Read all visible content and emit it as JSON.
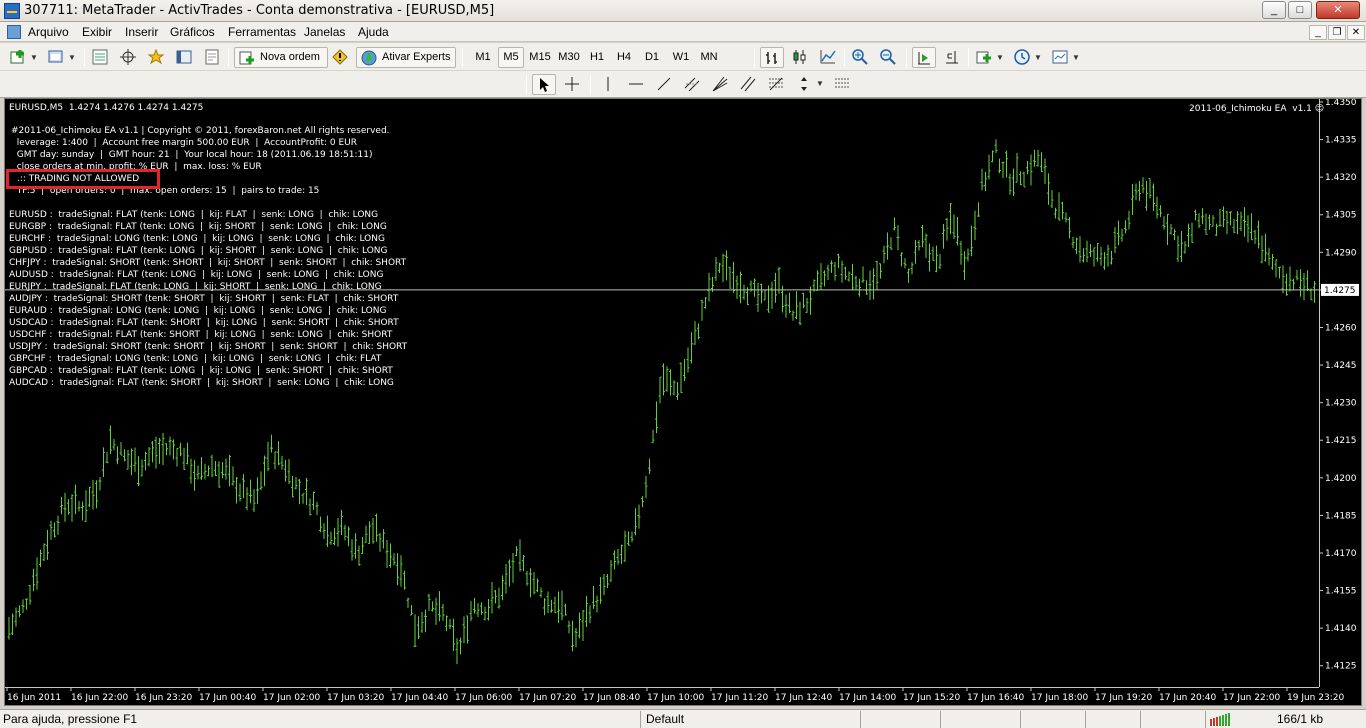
{
  "window": {
    "title": "307711: MetaTrader - ActivTrades - Conta demonstrativa - [EURUSD,M5]",
    "minimize": "_",
    "maximize": "□",
    "close": "✕"
  },
  "menu": {
    "items": [
      "Arquivo",
      "Exibir",
      "Inserir",
      "Gráficos",
      "Ferramentas",
      "Janelas",
      "Ajuda"
    ]
  },
  "toolbar": {
    "new_order": "Nova ordem",
    "experts": "Ativar Experts",
    "timeframes": [
      "M1",
      "M5",
      "M15",
      "M30",
      "H1",
      "H4",
      "D1",
      "W1",
      "MN"
    ],
    "active_timeframe": "M5"
  },
  "chart": {
    "header": "EURUSD,M5  1.4274 1.4276 1.4274 1.4275",
    "ea_label": "2011-06_Ichimoku EA  v1.1 ☺",
    "info_lines": [
      "#2011-06_Ichimoku EA v1.1 | Copyright © 2011, forexBaron.net All rights reserved.",
      "  leverage: 1:400  |  Account free margin 500.00 EUR  |  AccountProfit: 0 EUR",
      "  GMT day: sunday  |  GMT hour: 21  |  Your local hour: 18 (2011.06.19 18:51:11)",
      "  close orders at min. profit: % EUR  |  max. loss: % EUR",
      "",
      "  TF:5  |  open orders: 0  |  max. open orders: 15  |  pairs to trade: 15"
    ],
    "trading_status": ".:: TRADING NOT ALLOWED",
    "signals": [
      "EURUSD :  tradeSignal: FLAT (tenk: LONG  |  kij: FLAT  |  senk: LONG  |  chik: LONG",
      "EURGBP :  tradeSignal: FLAT (tenk: LONG  |  kij: SHORT  |  senk: LONG  |  chik: LONG",
      "EURCHF :  tradeSignal: LONG (tenk: LONG  |  kij: LONG  |  senk: LONG  |  chik: LONG",
      "GBPUSD :  tradeSignal: FLAT (tenk: LONG  |  kij: SHORT  |  senk: LONG  |  chik: LONG",
      "CHFJPY :  tradeSignal: SHORT (tenk: SHORT  |  kij: SHORT  |  senk: SHORT  |  chik: SHORT",
      "AUDUSD :  tradeSignal: FLAT (tenk: LONG  |  kij: LONG  |  senk: LONG  |  chik: LONG",
      "EURJPY :  tradeSignal: FLAT (tenk: LONG  |  kij: SHORT  |  senk: LONG  |  chik: LONG",
      "AUDJPY :  tradeSignal: SHORT (tenk: SHORT  |  kij: SHORT  |  senk: FLAT  |  chik: SHORT",
      "EURAUD :  tradeSignal: LONG (tenk: LONG  |  kij: LONG  |  senk: LONG  |  chik: LONG",
      "USDCAD :  tradeSignal: FLAT (tenk: SHORT  |  kij: LONG  |  senk: SHORT  |  chik: SHORT",
      "USDCHF :  tradeSignal: FLAT (tenk: SHORT  |  kij: LONG  |  senk: LONG  |  chik: SHORT",
      "USDJPY :  tradeSignal: SHORT (tenk: SHORT  |  kij: SHORT  |  senk: SHORT  |  chik: SHORT",
      "GBPCHF :  tradeSignal: LONG (tenk: LONG  |  kij: LONG  |  senk: LONG  |  chik: FLAT",
      "GBPCAD :  tradeSignal: FLAT (tenk: LONG  |  kij: LONG  |  senk: SHORT  |  chik: SHORT",
      "AUDCAD :  tradeSignal: FLAT (tenk: SHORT  |  kij: SHORT  |  senk: LONG  |  chik: LONG"
    ],
    "current_price": "1.4275",
    "colors": {
      "background": "#000000",
      "bars": "#5fd23a",
      "price_line": "#b8c7b0",
      "text": "#ffffff",
      "alert_box": "#e0262b"
    }
  },
  "chart_data": {
    "type": "line",
    "title": "EURUSD,M5  1.4274 1.4276 1.4274 1.4275",
    "y_ticks": [
      1.435,
      1.4335,
      1.432,
      1.4305,
      1.429,
      1.4275,
      1.426,
      1.4245,
      1.423,
      1.4215,
      1.42,
      1.4185,
      1.417,
      1.4155,
      1.414,
      1.4125
    ],
    "y_tick_labels": [
      "1.4350",
      "1.4335",
      "1.4320",
      "1.4305",
      "1.4290",
      "1.4275",
      "1.4260",
      "1.4245",
      "1.4230",
      "1.4215",
      "1.4200",
      "1.4185",
      "1.4170",
      "1.4155",
      "1.4140",
      "1.4125"
    ],
    "ylim": [
      1.41225,
      1.435
    ],
    "x_labels": [
      "16 Jun 2011",
      "16 Jun 22:00",
      "16 Jun 23:20",
      "17 Jun 00:40",
      "17 Jun 02:00",
      "17 Jun 03:20",
      "17 Jun 04:40",
      "17 Jun 06:00",
      "17 Jun 07:20",
      "17 Jun 08:40",
      "17 Jun 10:00",
      "17 Jun 11:20",
      "17 Jun 12:40",
      "17 Jun 14:00",
      "17 Jun 15:20",
      "17 Jun 16:40",
      "17 Jun 18:00",
      "17 Jun 19:20",
      "17 Jun 20:40",
      "17 Jun 22:00",
      "19 Jun 23:20"
    ],
    "series": [
      {
        "values": [
          1.414,
          1.4148,
          1.4165,
          1.418,
          1.419,
          1.4188,
          1.4195,
          1.4215,
          1.4208,
          1.4205,
          1.421,
          1.4212,
          1.421,
          1.42,
          1.4205,
          1.4202,
          1.4195,
          1.419,
          1.4212,
          1.4205,
          1.4195,
          1.419,
          1.4178,
          1.418,
          1.417,
          1.418,
          1.4172,
          1.4165,
          1.414,
          1.4148,
          1.4145,
          1.413,
          1.415,
          1.4148,
          1.4155,
          1.4168,
          1.416,
          1.415,
          1.415,
          1.4135,
          1.4148,
          1.4155,
          1.4168,
          1.4175,
          1.42,
          1.424,
          1.4235,
          1.425,
          1.427,
          1.4285,
          1.428,
          1.4275,
          1.427,
          1.4278,
          1.4265,
          1.427,
          1.4278,
          1.4285,
          1.428,
          1.4278,
          1.428,
          1.43,
          1.428,
          1.4295,
          1.4285,
          1.4305,
          1.4285,
          1.4315,
          1.433,
          1.432,
          1.4322,
          1.4328,
          1.431,
          1.43,
          1.429,
          1.4288,
          1.429,
          1.43,
          1.4318,
          1.431,
          1.43,
          1.429,
          1.4305,
          1.43,
          1.4302,
          1.43,
          1.4298,
          1.4285,
          1.428,
          1.4278,
          1.4275
        ],
        "color": "#5fd23a"
      }
    ],
    "grid": false,
    "current_price": 1.4275
  },
  "status": {
    "help": "Para ajuda, pressione F1",
    "profile": "Default",
    "traffic": "166/1 kb"
  }
}
